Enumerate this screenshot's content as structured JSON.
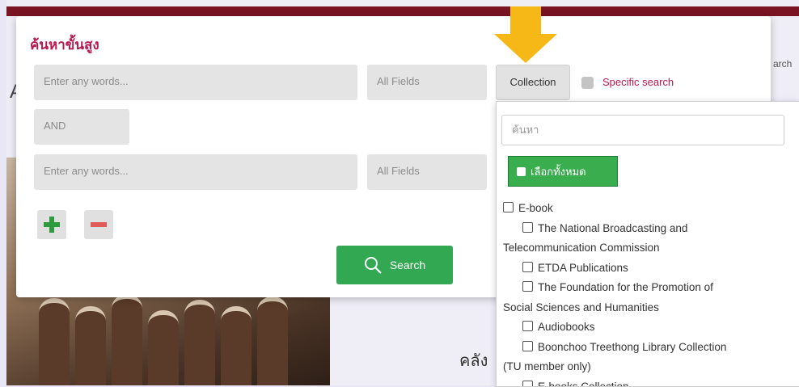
{
  "background": {
    "heading_fragment": "A",
    "link_fragment": "arch",
    "thai_fragment": "คลัง"
  },
  "advanced_search": {
    "title": "ค้นหาขั้นสูง",
    "row1": {
      "query_placeholder": "Enter any words...",
      "field_select": "All Fields"
    },
    "operator": "AND",
    "row2": {
      "query_placeholder": "Enter any words...",
      "field_select": "All Fields"
    },
    "add_icon": "plus-icon",
    "remove_icon": "minus-icon",
    "search_button": "Search",
    "collection_button": "Collection",
    "specific_search_label": "Specific search"
  },
  "collection_dropdown": {
    "search_placeholder": "ค้นหา",
    "select_all_label": "เลือกทั้งหมด",
    "items": [
      {
        "label": "E-book",
        "level": 0
      },
      {
        "label": "The National Broadcasting and",
        "label_cont": "Telecommunication Commission",
        "level": 1
      },
      {
        "label": "ETDA Publications",
        "level": 1
      },
      {
        "label": "The Foundation for the Promotion of",
        "label_cont": "Social Sciences and Humanities",
        "level": 1
      },
      {
        "label": "Audiobooks",
        "level": 1
      },
      {
        "label": "Boonchoo Treethong Library Collection",
        "label_cont": "(TU member only)",
        "level": 1
      },
      {
        "label": "E-books Collection",
        "level": 1
      }
    ]
  },
  "colors": {
    "accent": "#b81a4f",
    "search_green": "#32a852",
    "arrow_yellow": "#f6b817",
    "header_bar": "#7a1422"
  }
}
